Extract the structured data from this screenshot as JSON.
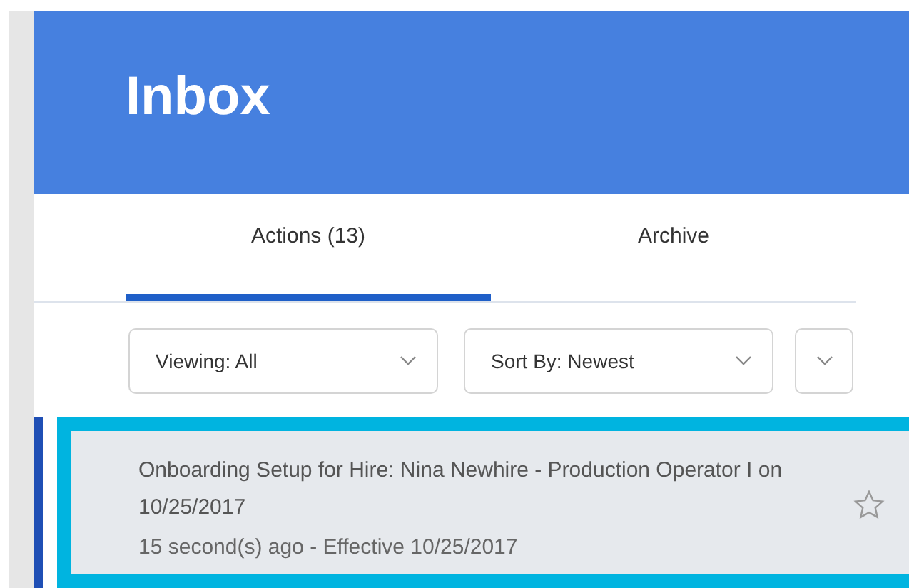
{
  "header": {
    "title": "Inbox"
  },
  "tabs": [
    {
      "label": "Actions (13)",
      "selected": true
    },
    {
      "label": "Archive",
      "selected": false
    }
  ],
  "filters": [
    {
      "kind": "dropdown",
      "value": "Viewing: All"
    },
    {
      "kind": "dropdown",
      "value": "Sort By: Newest"
    },
    {
      "kind": "toggle"
    }
  ],
  "items": [
    {
      "title": "Onboarding Setup for Hire: Nina Newhire - Production Operator I on 10/25/2017",
      "subtitle": "15 second(s) ago - Effective 10/25/2017",
      "selected": true,
      "starred": false
    }
  ]
}
